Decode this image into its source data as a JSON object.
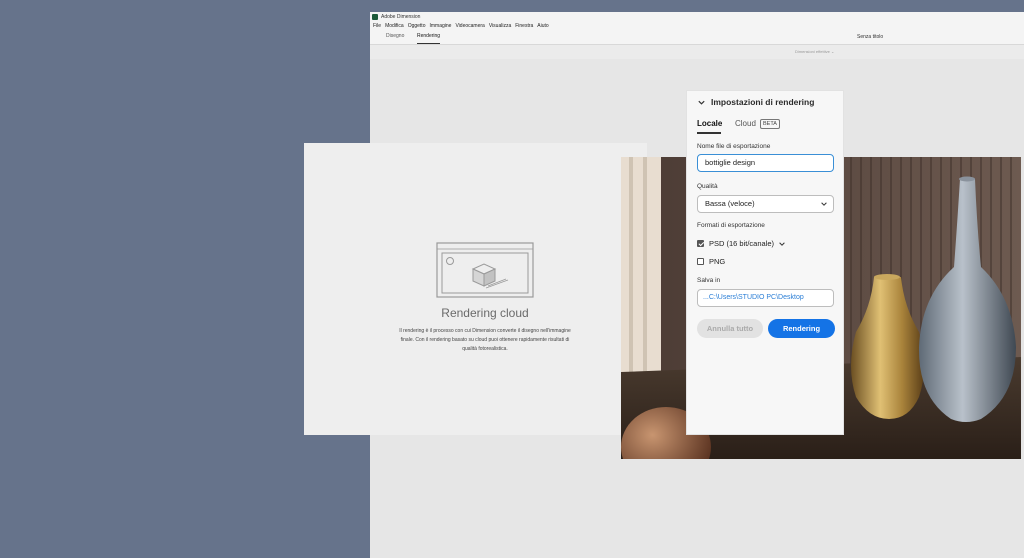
{
  "window": {
    "app_title": "Adobe Dimension"
  },
  "menu": [
    "File",
    "Modifica",
    "Oggetto",
    "Immagine",
    "Videocamera",
    "Visualizza",
    "Finestra",
    "Aiuto"
  ],
  "tabs": {
    "design": "Disegno",
    "render": "Rendering"
  },
  "document_title": "Senza titolo",
  "view_mode": "Dimensioni effettive",
  "cloud_info": {
    "title": "Rendering cloud",
    "description": "Il rendering è il processo con cui Dimension converte il disegno nell'immagine finale. Con il rendering basato su cloud puoi ottenere rapidamente risultati di qualità fotorealistica."
  },
  "settings": {
    "title": "Impostazioni di rendering",
    "tab_local": "Locale",
    "tab_cloud": "Cloud",
    "beta": "BETA",
    "filename_label": "Nome file di esportazione",
    "filename_value": "bottiglie design",
    "quality_label": "Qualità",
    "quality_value": "Bassa (veloce)",
    "formats_label": "Formati di esportazione",
    "format_psd": "PSD (16 bit/canale)",
    "format_psd_checked": true,
    "format_png": "PNG",
    "format_png_checked": false,
    "save_label": "Salva in",
    "save_path": "...C:\\Users\\STUDIO PC\\Desktop",
    "cancel_button": "Annulla tutto",
    "render_button": "Rendering"
  },
  "colors": {
    "desktop": "#66738b",
    "accent": "#1473e6",
    "app_icon": "#1c5a39"
  }
}
